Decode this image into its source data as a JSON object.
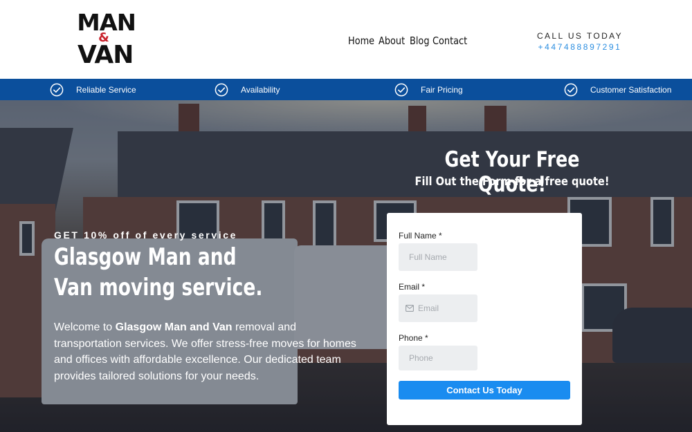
{
  "brand": {
    "line1": "MAN",
    "amp": "&",
    "line2": "VAN"
  },
  "nav": {
    "items": [
      "Home",
      "About",
      "Blog",
      "Contact"
    ]
  },
  "call": {
    "label": "CALL US TODAY",
    "phone": "+447488897291"
  },
  "features": [
    {
      "label": "Reliable Service",
      "icon": "check-circle-icon"
    },
    {
      "label": "Availability",
      "icon": "check-circle-icon"
    },
    {
      "label": "Fair Pricing",
      "icon": "check-circle-icon"
    },
    {
      "label": "Customer Satisfaction",
      "icon": "check-circle-icon"
    }
  ],
  "hero": {
    "promo": "GET 10% off of every service",
    "title": "Glasgow Man and Van moving service.",
    "text_before": "Welcome to ",
    "text_bold": "Glasgow Man and Van",
    "text_after": " removal and transportation services. We offer stress-free moves for homes and offices with affordable excellence. Our dedicated team provides tailored solutions for your needs."
  },
  "quote": {
    "title": "Get Your Free Quote!",
    "subtitle": "Fill Out the Form for a free quote!"
  },
  "form": {
    "name_label": "Full Name *",
    "name_placeholder": "Full Name",
    "email_label": "Email *",
    "email_placeholder": "Email",
    "phone_label": "Phone *",
    "phone_placeholder": "Phone",
    "submit_label": "Contact Us Today"
  },
  "colors": {
    "brand_blue": "#0b4f9c",
    "accent_blue": "#1a8cf0",
    "logo_red": "#c8202a"
  }
}
